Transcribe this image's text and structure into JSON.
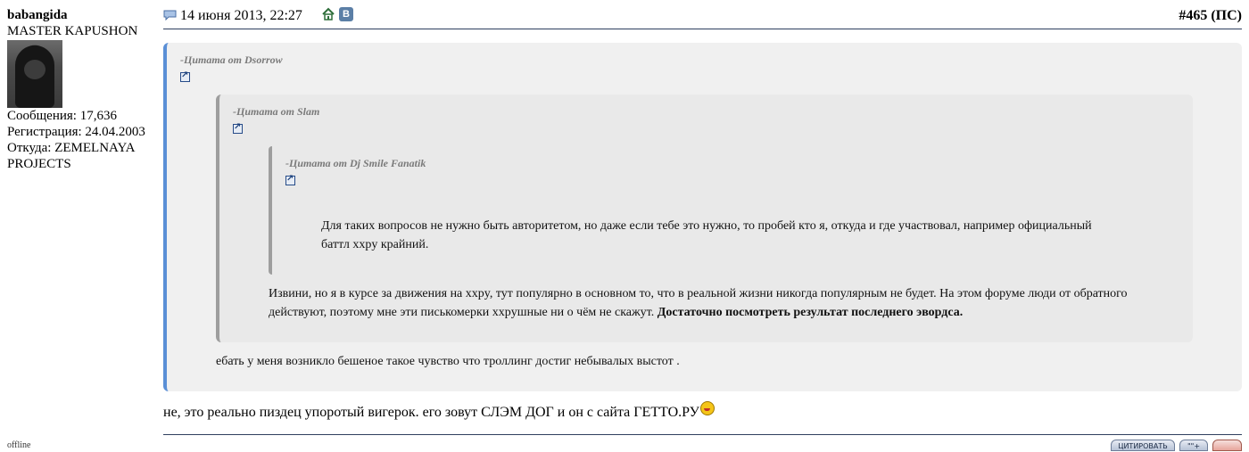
{
  "user": {
    "name": "babangida",
    "title": "MASTER KAPUSHON",
    "posts_label": "Сообщения: 17,636",
    "registered_label": "Регистрация: 24.04.2003",
    "location_label_line1": "Откуда: ZEMELNAYA",
    "location_label_line2": "PROJECTS",
    "status": "offline"
  },
  "post": {
    "date": "14 июня 2013, 22:27",
    "number": "#465",
    "suffix": "(ПС)",
    "vk_label": "В"
  },
  "quotes": {
    "outer_author": "-Цитата от Dsorrow",
    "middle_author": "-Цитата от Slam",
    "inner_author": "-Цитата от Dj Smile Fanatik",
    "inner_text": "Для таких вопросов не нужно быть авторитетом, но даже если тебе это нужно, то пробей кто я, откуда и где участвовал, например официальный баттл xxpy крайний.",
    "middle_text": "Извини, но я в курсе за движения на xxpy, тут популярно в основном то, что в реальной жизни никогда популярным не будет. На этом форуме люди от обратного действуют, поэтому мне эти писькомерки xxpушные ни о чём не скажут.",
    "middle_bold": "Достаточно посмотреть результат последнего эвордса.",
    "outer_text": "ебать у меня возникло бешеное такое чувство что троллинг достиг небывалых выстот ."
  },
  "message": "не, это реально пиздец упоротый вигерок. его зовут СЛЭМ ДОГ и он с сайта ГЕТТО.РУ",
  "buttons": {
    "quote": "ЦИТИРОВАТЬ",
    "multi": "\"\"+",
    "reply": ""
  }
}
